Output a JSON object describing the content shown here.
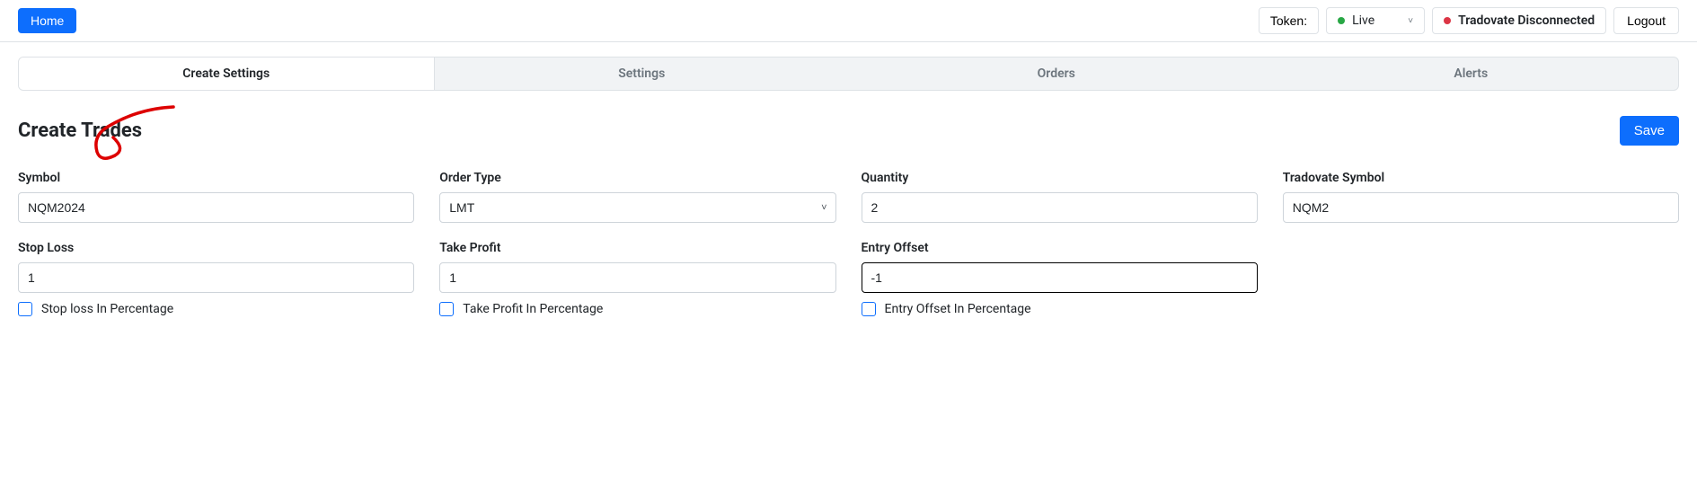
{
  "topbar": {
    "home": "Home",
    "token": "Token:",
    "live_label": "Live",
    "status": "Tradovate Disconnected",
    "logout": "Logout"
  },
  "tabs": {
    "create_settings": "Create Settings",
    "settings": "Settings",
    "orders": "Orders",
    "alerts": "Alerts"
  },
  "header": {
    "title": "Create Trades",
    "save": "Save"
  },
  "form": {
    "symbol": {
      "label": "Symbol",
      "value": "NQM2024"
    },
    "order_type": {
      "label": "Order Type",
      "value": "LMT"
    },
    "quantity": {
      "label": "Quantity",
      "value": "2"
    },
    "tradovate_symbol": {
      "label": "Tradovate Symbol",
      "value": "NQM2"
    },
    "stop_loss": {
      "label": "Stop Loss",
      "value": "1",
      "checkbox_label": "Stop loss In Percentage"
    },
    "take_profit": {
      "label": "Take Profit",
      "value": "1",
      "checkbox_label": "Take Profit In Percentage"
    },
    "entry_offset": {
      "label": "Entry Offset",
      "value": "-1",
      "checkbox_label": "Entry Offset In Percentage"
    }
  }
}
